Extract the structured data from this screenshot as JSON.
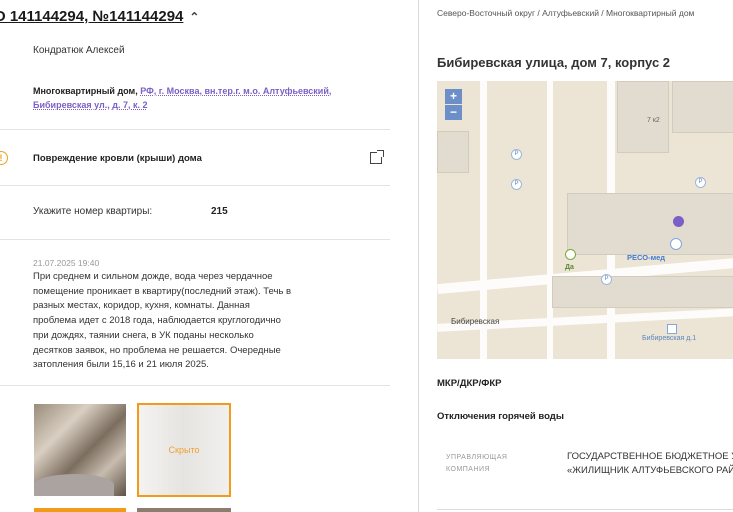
{
  "ticket": {
    "title": "О 141144294, №141144294",
    "chevron": "^",
    "author": "Кондратюк Алексей",
    "address_prefix": "Многоквартирный дом,",
    "address_link": "РФ, г. Москва, вн.тер.г. м.о. Алтуфьевский, Бибиревская ул., д. 7, к. 2",
    "problem": "Повреждение кровли (крыши) дома",
    "apartment_label": "Укажите номер квартиры:",
    "apartment_value": "215",
    "date": "21.07.2025 19:40",
    "text": "При среднем и сильном дожде, вода через чердачное помещение проникает в квартиру(последний этаж). Течь в разных местах, коридор, кухня, комнаты. Данная проблема идет с 2018 года, наблюдается круглогодично при дождях, таянии снега, в УК поданы несколько десятков заявок, но проблема не решается. Очередные затопления были 15,16 и 21 июля 2025.",
    "hidden_label": "Скрыто"
  },
  "building": {
    "breadcrumb": "Северо-Восточный округ / Алтуфьевский / Многоквартирный дом",
    "street_title": "Бибиревская улица, дом 7, корпус 2",
    "map": {
      "zoom_in": "+",
      "zoom_out": "−",
      "label_7k2": "7 к2",
      "poi_reso": "РЕСО-мед",
      "poi_da": "Да",
      "road_label": "Бибиревская",
      "bus_stop": "Бибиревская д.1",
      "parking": "P"
    },
    "section_mkd": "МКР/ДКР/ФКР",
    "section_hotwater": "Отключения горячей воды",
    "uk_label": "УПРАВЛЯЮЩАЯ КОМПАНИЯ",
    "uk_value_line1": "ГОСУДАРСТВЕННОЕ БЮДЖЕТНОЕ УЧ",
    "uk_value_line2": "«ЖИЛИЩНИК АЛТУФЬЕВСКОГО РАЙО"
  },
  "colors": {
    "accent": "#7b5fc7",
    "warning": "#f0a020",
    "highlight_border": "#f29a1a"
  }
}
